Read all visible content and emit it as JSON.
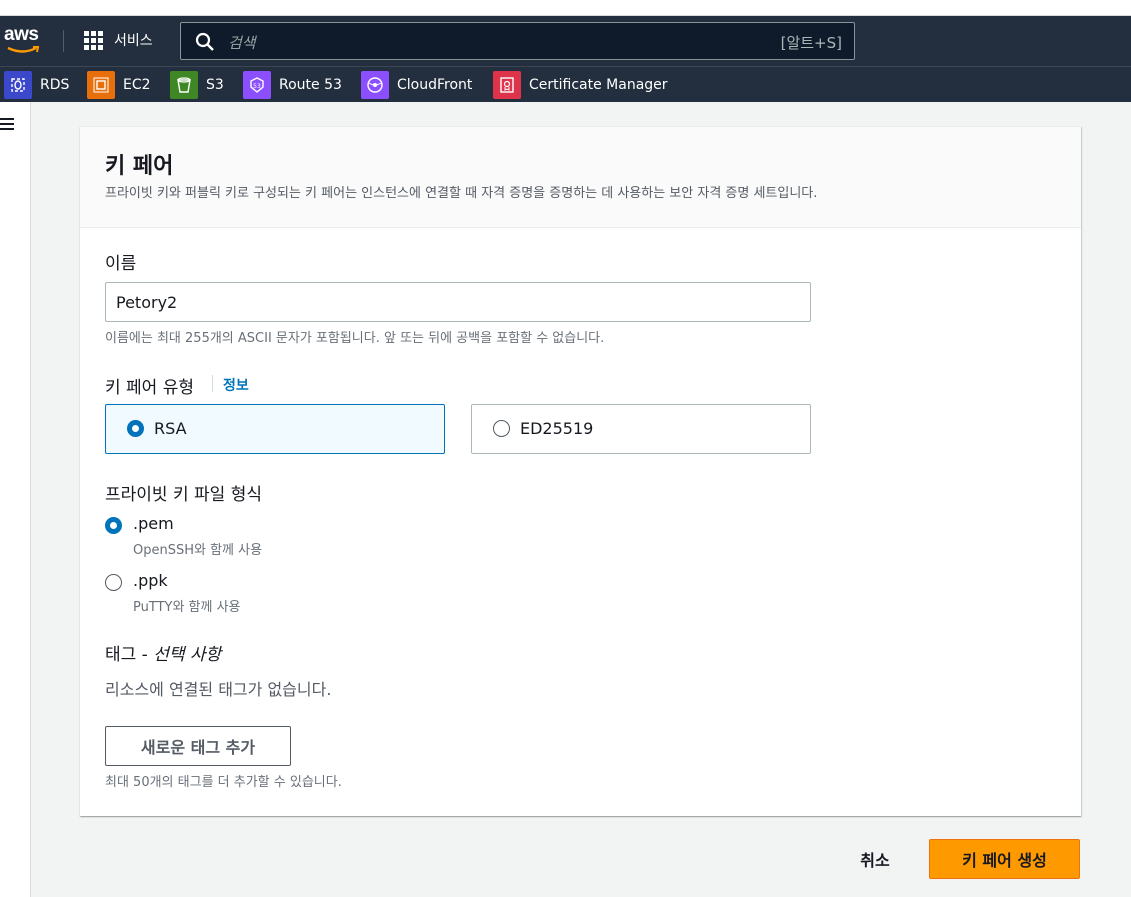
{
  "header": {
    "logo_text": "aws",
    "services_label": "서비스",
    "search_placeholder": "검색",
    "search_shortcut": "[알트+S]"
  },
  "favorites": [
    {
      "label": "RDS",
      "icon": "rds-icon",
      "color": "#3b48cc"
    },
    {
      "label": "EC2",
      "icon": "ec2-icon",
      "color": "#e7700d"
    },
    {
      "label": "S3",
      "icon": "s3-icon",
      "color": "#3f8624"
    },
    {
      "label": "Route 53",
      "icon": "route53-icon",
      "color": "#8c4fff"
    },
    {
      "label": "CloudFront",
      "icon": "cloudfront-icon",
      "color": "#8c4fff"
    },
    {
      "label": "Certificate Manager",
      "icon": "certificate-manager-icon",
      "color": "#dd344c"
    }
  ],
  "panel": {
    "title": "키 페어",
    "description": "프라이빗 키와 퍼블릭 키로 구성되는 키 페어는 인스턴스에 연결할 때 자격 증명을 증명하는 데 사용하는 보안 자격 증명 세트입니다."
  },
  "name_field": {
    "label": "이름",
    "value": "Petory2",
    "hint": "이름에는 최대 255개의 ASCII 문자가 포함됩니다. 앞 또는 뒤에 공백을 포함할 수 없습니다."
  },
  "key_type": {
    "label": "키 페어 유형",
    "info_link": "정보",
    "options": [
      {
        "label": "RSA",
        "selected": true
      },
      {
        "label": "ED25519",
        "selected": false
      }
    ]
  },
  "file_format": {
    "label": "프라이빗 키 파일 형식",
    "options": [
      {
        "label": ".pem",
        "description": "OpenSSH와 함께 사용",
        "selected": true
      },
      {
        "label": ".ppk",
        "description": "PuTTY와 함께 사용",
        "selected": false
      }
    ]
  },
  "tags": {
    "label": "태그 -",
    "label_optional": "선택 사항",
    "empty_text": "리소스에 연결된 태그가 없습니다.",
    "add_button": "새로운 태그 추가",
    "limit_hint": "최대 50개의 태그를 더 추가할 수 있습니다."
  },
  "footer": {
    "cancel_label": "취소",
    "create_label": "키 페어 생성"
  },
  "colors": {
    "accent": "#ff9900",
    "link": "#0073bb",
    "nav_bg": "#232f3e"
  }
}
